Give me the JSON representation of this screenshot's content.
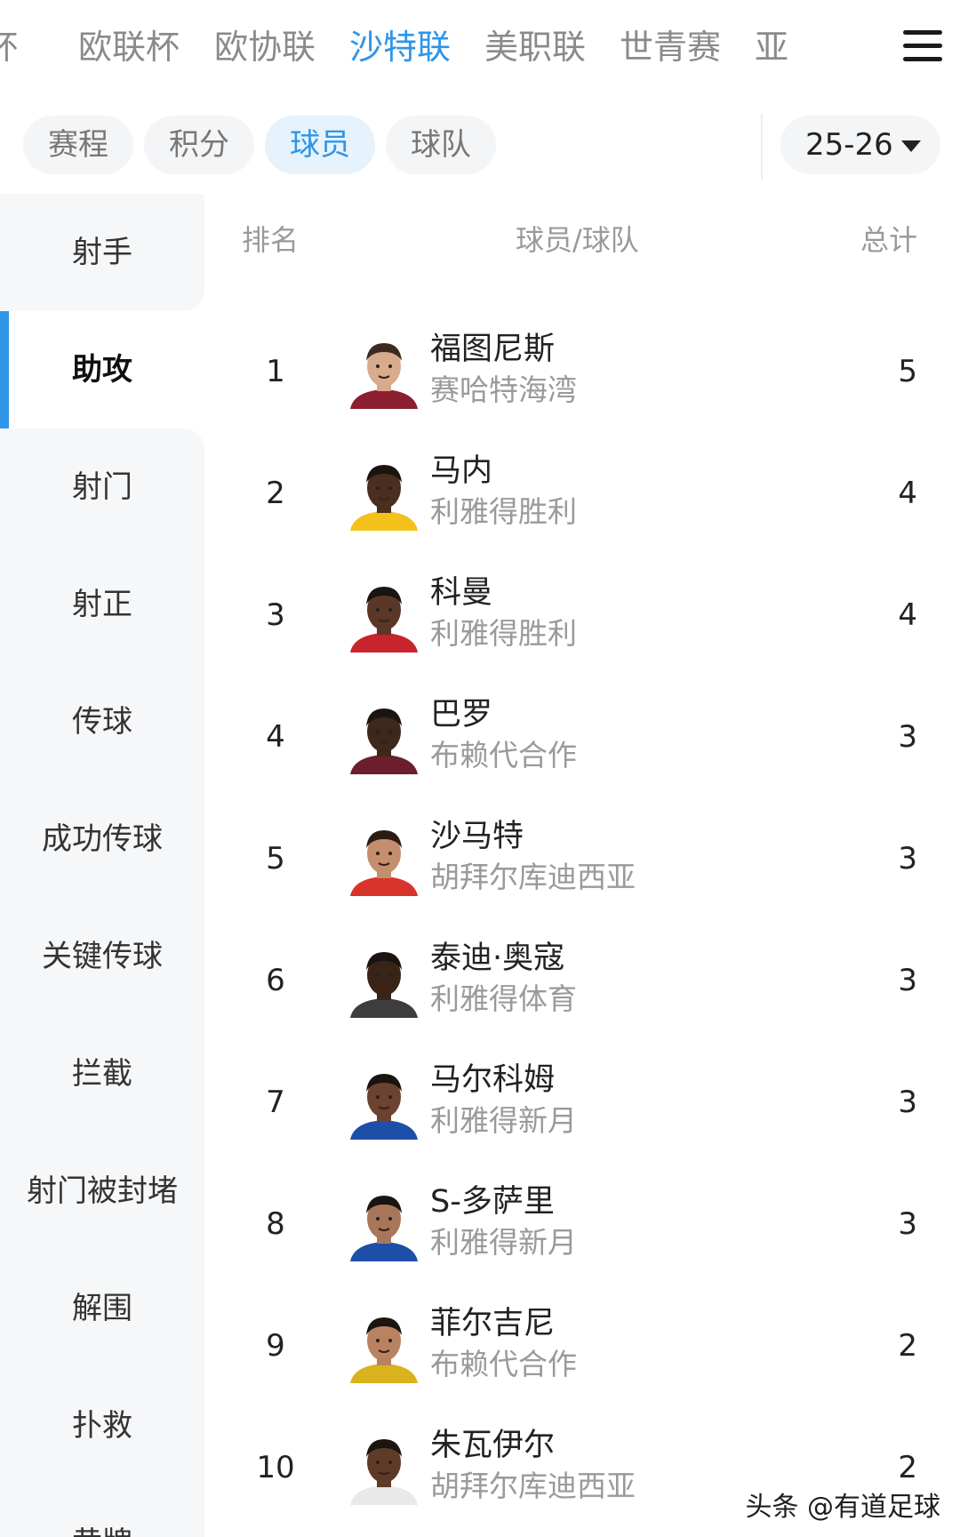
{
  "league_tabs": [
    {
      "label": "杯"
    },
    {
      "label": "欧联杯"
    },
    {
      "label": "欧协联"
    },
    {
      "label": "沙特联",
      "active": true
    },
    {
      "label": "美职联"
    },
    {
      "label": "世青赛"
    },
    {
      "label": "亚"
    }
  ],
  "sub_tabs": [
    {
      "label": "赛程"
    },
    {
      "label": "积分"
    },
    {
      "label": "球员",
      "active": true
    },
    {
      "label": "球队"
    }
  ],
  "season": {
    "value": "25-26"
  },
  "categories": [
    {
      "label": "射手"
    },
    {
      "label": "助攻",
      "active": true
    },
    {
      "label": "射门"
    },
    {
      "label": "射正"
    },
    {
      "label": "传球"
    },
    {
      "label": "成功传球"
    },
    {
      "label": "关键传球"
    },
    {
      "label": "拦截"
    },
    {
      "label": "射门被封堵"
    },
    {
      "label": "解围"
    },
    {
      "label": "扑救"
    },
    {
      "label": "黄牌"
    }
  ],
  "table": {
    "headers": {
      "rank": "排名",
      "player_team": "球员/球队",
      "total": "总计"
    },
    "rows": [
      {
        "rank": "1",
        "player": "福图尼斯",
        "team": "赛哈特海湾",
        "total": "5",
        "skin": "#d8ab8c",
        "hair": "#3a2a20",
        "shirt": "#8b1e2f"
      },
      {
        "rank": "2",
        "player": "马内",
        "team": "利雅得胜利",
        "total": "4",
        "skin": "#4a2e1f",
        "hair": "#1b1410",
        "shirt": "#f2c21b"
      },
      {
        "rank": "3",
        "player": "科曼",
        "team": "利雅得胜利",
        "total": "4",
        "skin": "#5a3726",
        "hair": "#1b1410",
        "shirt": "#c7242b"
      },
      {
        "rank": "4",
        "player": "巴罗",
        "team": "布赖代合作",
        "total": "3",
        "skin": "#3e271b",
        "hair": "#1b1410",
        "shirt": "#6b1f2c"
      },
      {
        "rank": "5",
        "player": "沙马特",
        "team": "胡拜尔库迪西亚",
        "total": "3",
        "skin": "#c48f6c",
        "hair": "#2a1c14",
        "shirt": "#d9342b"
      },
      {
        "rank": "6",
        "player": "泰迪·奥寇",
        "team": "利雅得体育",
        "total": "3",
        "skin": "#3a2418",
        "hair": "#1b1410",
        "shirt": "#3d3d3d"
      },
      {
        "rank": "7",
        "player": "马尔科姆",
        "team": "利雅得新月",
        "total": "3",
        "skin": "#6b4330",
        "hair": "#1b1410",
        "shirt": "#1e4fa8"
      },
      {
        "rank": "8",
        "player": "S-多萨里",
        "team": "利雅得新月",
        "total": "3",
        "skin": "#a8775a",
        "hair": "#1b1410",
        "shirt": "#1e4fa8"
      },
      {
        "rank": "9",
        "player": "菲尔吉尼",
        "team": "布赖代合作",
        "total": "2",
        "skin": "#b98260",
        "hair": "#1b1410",
        "shirt": "#d9b21e"
      },
      {
        "rank": "10",
        "player": "朱瓦伊尔",
        "team": "胡拜尔库迪西亚",
        "total": "2",
        "skin": "#5e3a28",
        "hair": "#1b1410",
        "shirt": "#e9e9e9"
      }
    ]
  },
  "watermark": "头条 @有道足球",
  "colors": {
    "accent": "#2f95e8",
    "sidebar_bg": "#f6f7f9",
    "muted": "#9a9a9a"
  },
  "icons": {
    "menu": "hamburger-menu-icon",
    "season_dropdown": "caret-down-icon"
  }
}
